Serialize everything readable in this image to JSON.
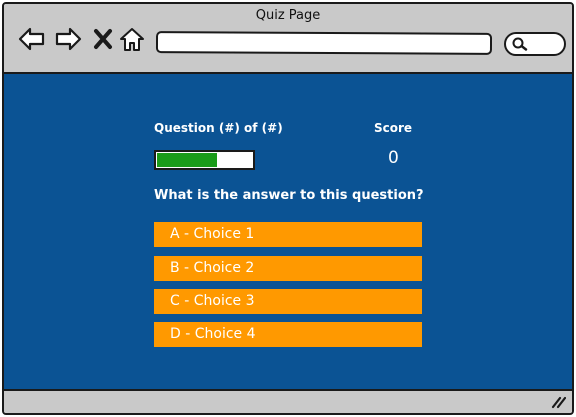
{
  "window": {
    "title": "Quiz Page"
  },
  "browser": {
    "url": "",
    "nav_icons": [
      "back-arrow-icon",
      "forward-arrow-icon",
      "close-x-icon",
      "home-icon"
    ],
    "search_icon": "search-icon"
  },
  "quiz": {
    "question_counter": "Question (#) of (#)",
    "score_label": "Score",
    "score_value": "0",
    "progress_fraction": 0.63,
    "question_text": "What is the answer to this question?",
    "choices": [
      {
        "label": "A - Choice 1"
      },
      {
        "label": "B - Choice 2"
      },
      {
        "label": "C - Choice 3"
      },
      {
        "label": "D - Choice 4"
      }
    ]
  },
  "colors": {
    "content_background": "#0b5394",
    "choice_background": "#ff9900",
    "progress_fill": "#1a9c1a",
    "chrome": "#c9c9c9"
  }
}
